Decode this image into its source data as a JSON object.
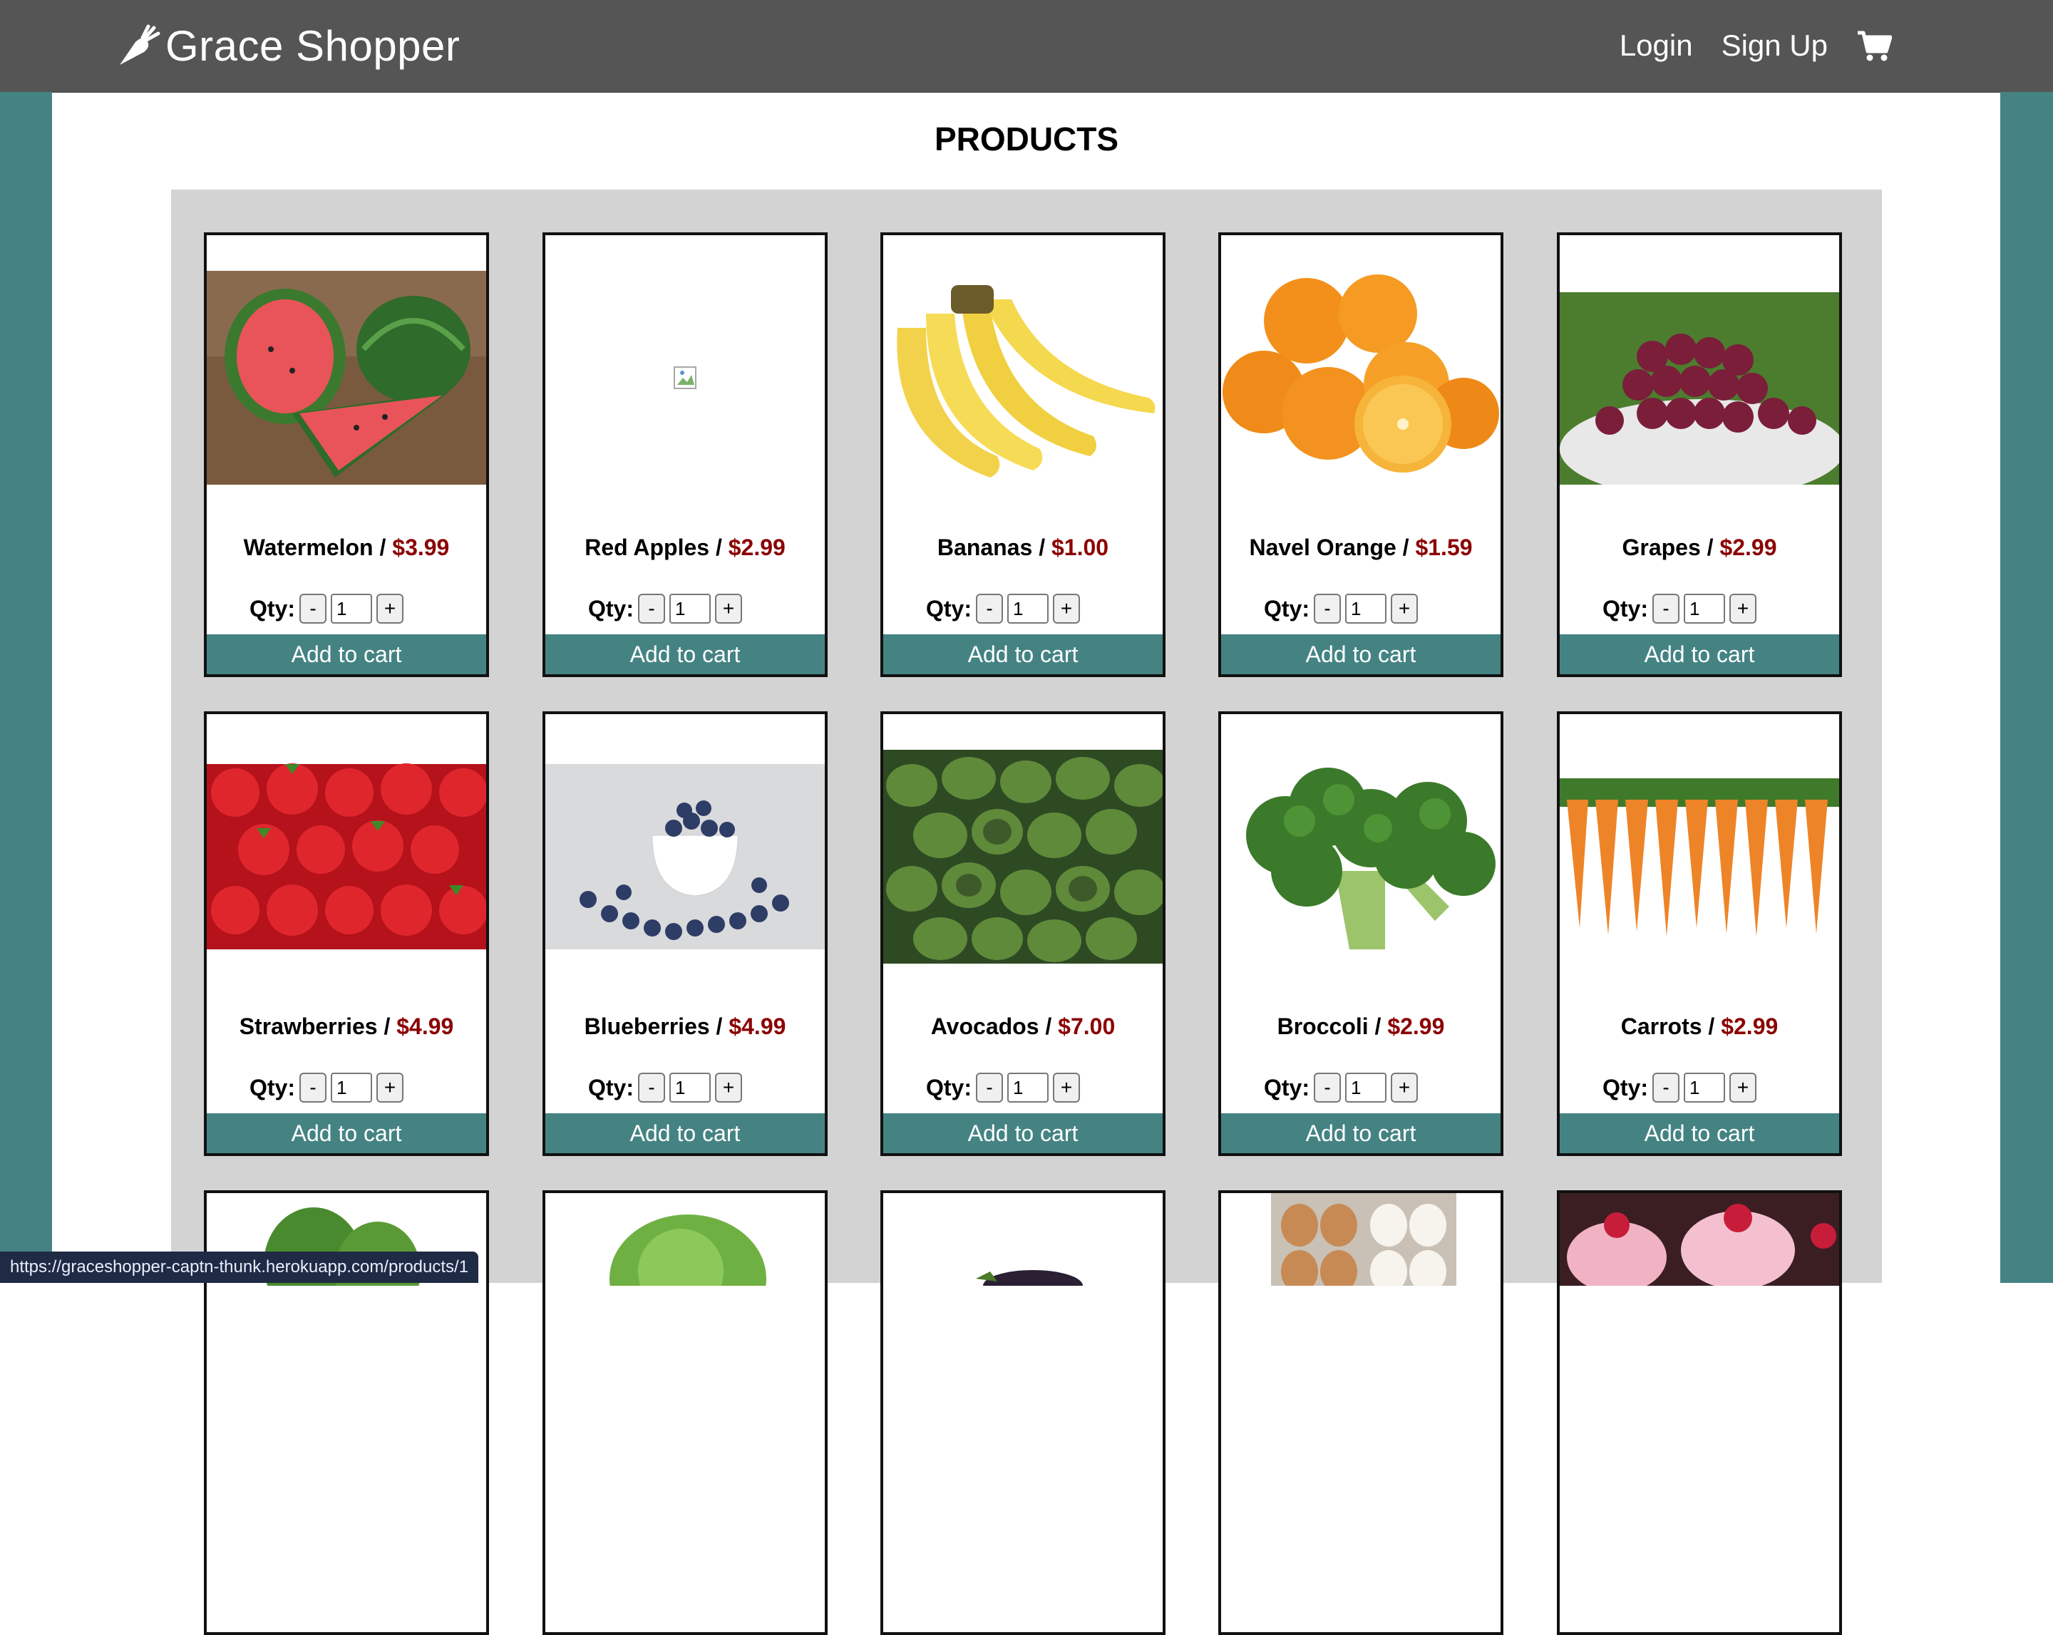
{
  "navbar": {
    "brand": "Grace Shopper",
    "brand_icon": "carrot-icon",
    "links": [
      "Login",
      "Sign Up"
    ],
    "cart_icon": "cart-icon"
  },
  "page": {
    "title": "PRODUCTS"
  },
  "product_card": {
    "qty_label": "Qty:",
    "minus": "-",
    "plus": "+",
    "add_label": "Add to cart"
  },
  "products": [
    {
      "name": "Watermelon",
      "price": "$3.99",
      "qty": "1",
      "image": "watermelon"
    },
    {
      "name": "Red Apples",
      "price": "$2.99",
      "qty": "1",
      "image": "broken-image"
    },
    {
      "name": "Bananas",
      "price": "$1.00",
      "qty": "1",
      "image": "bananas"
    },
    {
      "name": "Navel Orange",
      "price": "$1.59",
      "qty": "1",
      "image": "oranges"
    },
    {
      "name": "Grapes",
      "price": "$2.99",
      "qty": "1",
      "image": "grapes"
    },
    {
      "name": "Strawberries",
      "price": "$4.99",
      "qty": "1",
      "image": "strawberries"
    },
    {
      "name": "Blueberries",
      "price": "$4.99",
      "qty": "1",
      "image": "blueberries"
    },
    {
      "name": "Avocados",
      "price": "$7.00",
      "qty": "1",
      "image": "avocados"
    },
    {
      "name": "Broccoli",
      "price": "$2.99",
      "qty": "1",
      "image": "broccoli"
    },
    {
      "name": "Carrots",
      "price": "$2.99",
      "qty": "1",
      "image": "carrots"
    }
  ],
  "partial_row_images": [
    "spinach",
    "lettuce",
    "eggplant",
    "eggs",
    "cupcakes"
  ],
  "status_bar": {
    "url": "https://graceshopper-captn-thunk.herokuapp.com/products/1"
  },
  "colors": {
    "navbar": "#555555",
    "accent": "#458383",
    "price": "#8b0000",
    "panel": "#d3d3d3"
  }
}
